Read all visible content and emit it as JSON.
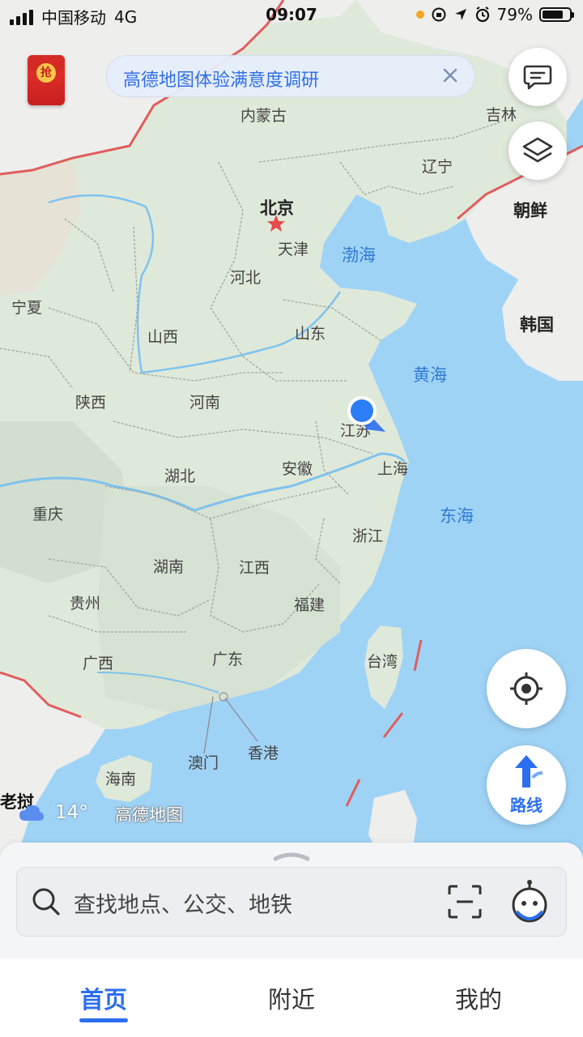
{
  "status_bar": {
    "carrier": "中国移动",
    "network": "4G",
    "time": "09:07",
    "battery": "79%",
    "battery_level": 0.79
  },
  "survey_banner": {
    "text": "高德地图体验满意度调研"
  },
  "red_packet": {
    "label": "抢"
  },
  "map": {
    "labels": {
      "neimenggu": "内蒙古",
      "jilin": "吉林",
      "liaoning": "辽宁",
      "chaoxian": "朝鲜",
      "beijing": "北京",
      "tianjin": "天津",
      "bohai": "渤海",
      "hebei": "河北",
      "ningxia": "宁夏",
      "hanguo": "韩国",
      "shanxi": "山西",
      "shandong": "山东",
      "huanghai": "黄海",
      "shaanxi": "陕西",
      "henan": "河南",
      "jiangsu": "江苏",
      "hubei": "湖北",
      "anhui": "安徽",
      "shanghai": "上海",
      "chongqing": "重庆",
      "donghai": "东海",
      "zhejiang": "浙江",
      "hunan": "湖南",
      "jiangxi": "江西",
      "guizhou": "贵州",
      "fujian": "福建",
      "guangxi": "广西",
      "guangdong": "广东",
      "taiwan": "台湾",
      "aomen": "澳门",
      "xianggang": "香港",
      "hainan": "海南",
      "laowo": "老挝"
    }
  },
  "weather": {
    "temperature": "14°",
    "icon": "cloud-icon"
  },
  "brand": "高德地图",
  "search": {
    "placeholder": "查找地点、公交、地铁"
  },
  "tabs": [
    {
      "label": "首页",
      "active": true
    },
    {
      "label": "附近",
      "active": false
    },
    {
      "label": "我的",
      "active": false
    }
  ],
  "route_button": {
    "label": "路线"
  },
  "colors": {
    "accent": "#2b6ef0",
    "sea": "#9fd3f6",
    "land": "#dfe9da",
    "border": "#e05d5d"
  }
}
